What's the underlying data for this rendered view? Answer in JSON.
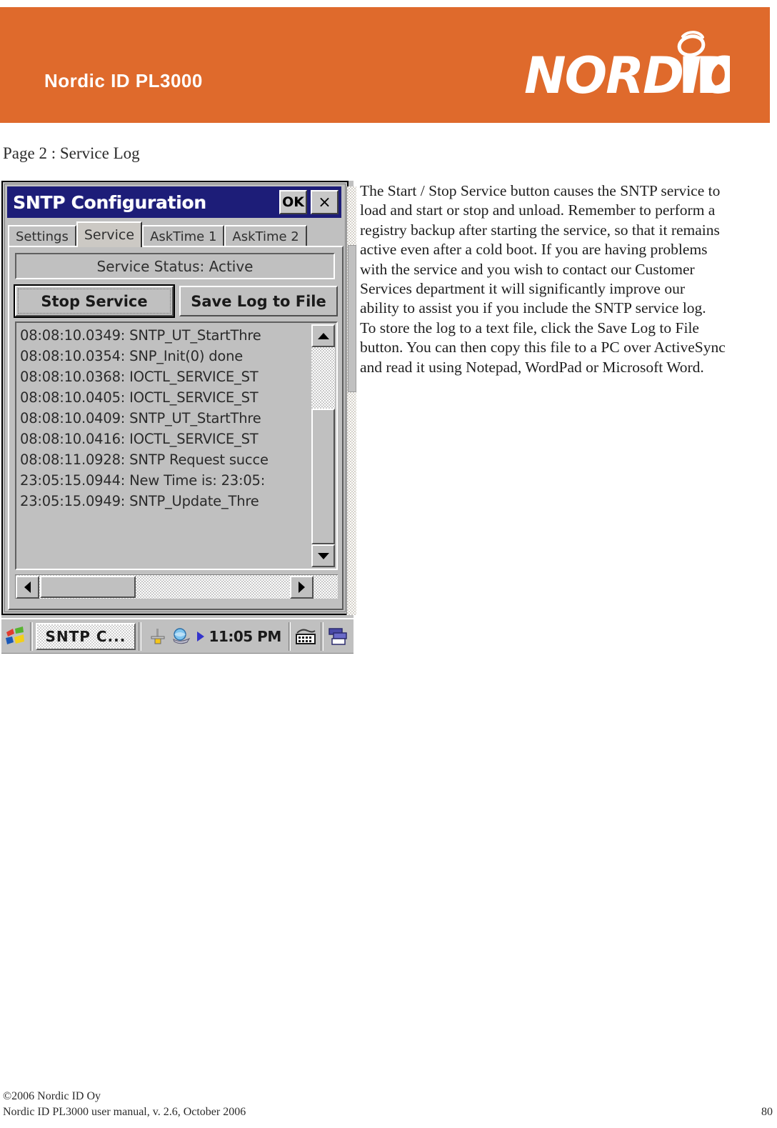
{
  "header": {
    "product_title": "Nordic ID PL3000",
    "brand_logo_text": "NORDICID",
    "band_color": "#DF6A2C"
  },
  "page_heading": "Page 2 : Service Log",
  "device_screenshot": {
    "window": {
      "title": "SNTP Configuration",
      "titlebar_color": "#1d1d78",
      "ok_button": "OK",
      "close_button": "×"
    },
    "tabs": [
      {
        "label": "Settings",
        "active": false
      },
      {
        "label": "Service",
        "active": true
      },
      {
        "label": "AskTime 1",
        "active": false
      },
      {
        "label": "AskTime 2",
        "active": false
      }
    ],
    "status_label": "Service Status: Active",
    "buttons": {
      "stop_service": "Stop Service",
      "save_log": "Save Log to File"
    },
    "log_lines": [
      "08:08:10.0349: SNTP_UT_StartThre",
      "08:08:10.0354: SNP_Init(0) done",
      "08:08:10.0368: IOCTL_SERVICE_ST",
      "08:08:10.0405: IOCTL_SERVICE_ST",
      "08:08:10.0409: SNTP_UT_StartThre",
      "08:08:10.0416: IOCTL_SERVICE_ST",
      "08:08:11.0928: SNTP Request succe",
      "23:05:15.0944: New Time is: 23:05:",
      "23:05:15.0949: SNTP_Update_Thre"
    ],
    "taskbar": {
      "start_icon": "windows-flag-icon",
      "task_button": "SNTP C...",
      "tray_icons": [
        "network-plug-icon",
        "activesync-globe-icon",
        "play-arrow-icon"
      ],
      "clock": "11:05 PM",
      "sip_icon": "keyboard-icon",
      "desktop_icon": "windows-stack-icon"
    },
    "scrollbars": {
      "vertical_up": "scroll-up-arrow",
      "vertical_down": "scroll-down-arrow",
      "horizontal_left": "scroll-left-arrow",
      "horizontal_right": "scroll-right-arrow"
    }
  },
  "body_paragraph": "The Start / Stop Service button causes the SNTP service to load and start or stop and unload. Remember to perform a registry backup after starting the service, so that it remains active even after a cold boot. If you are having problems with the service and you wish to contact our Customer Services department it will significantly improve our ability to assist you if you include the SNTP service log. To store the log to a text file, click the Save Log to File button. You can then copy this file to a PC over ActiveSync and read it using Notepad, WordPad or Microsoft Word.",
  "footer": {
    "copyright": "©2006 Nordic ID Oy",
    "manual_line": "Nordic ID PL3000 user manual, v. 2.6, October 2006",
    "page_number": "80"
  }
}
